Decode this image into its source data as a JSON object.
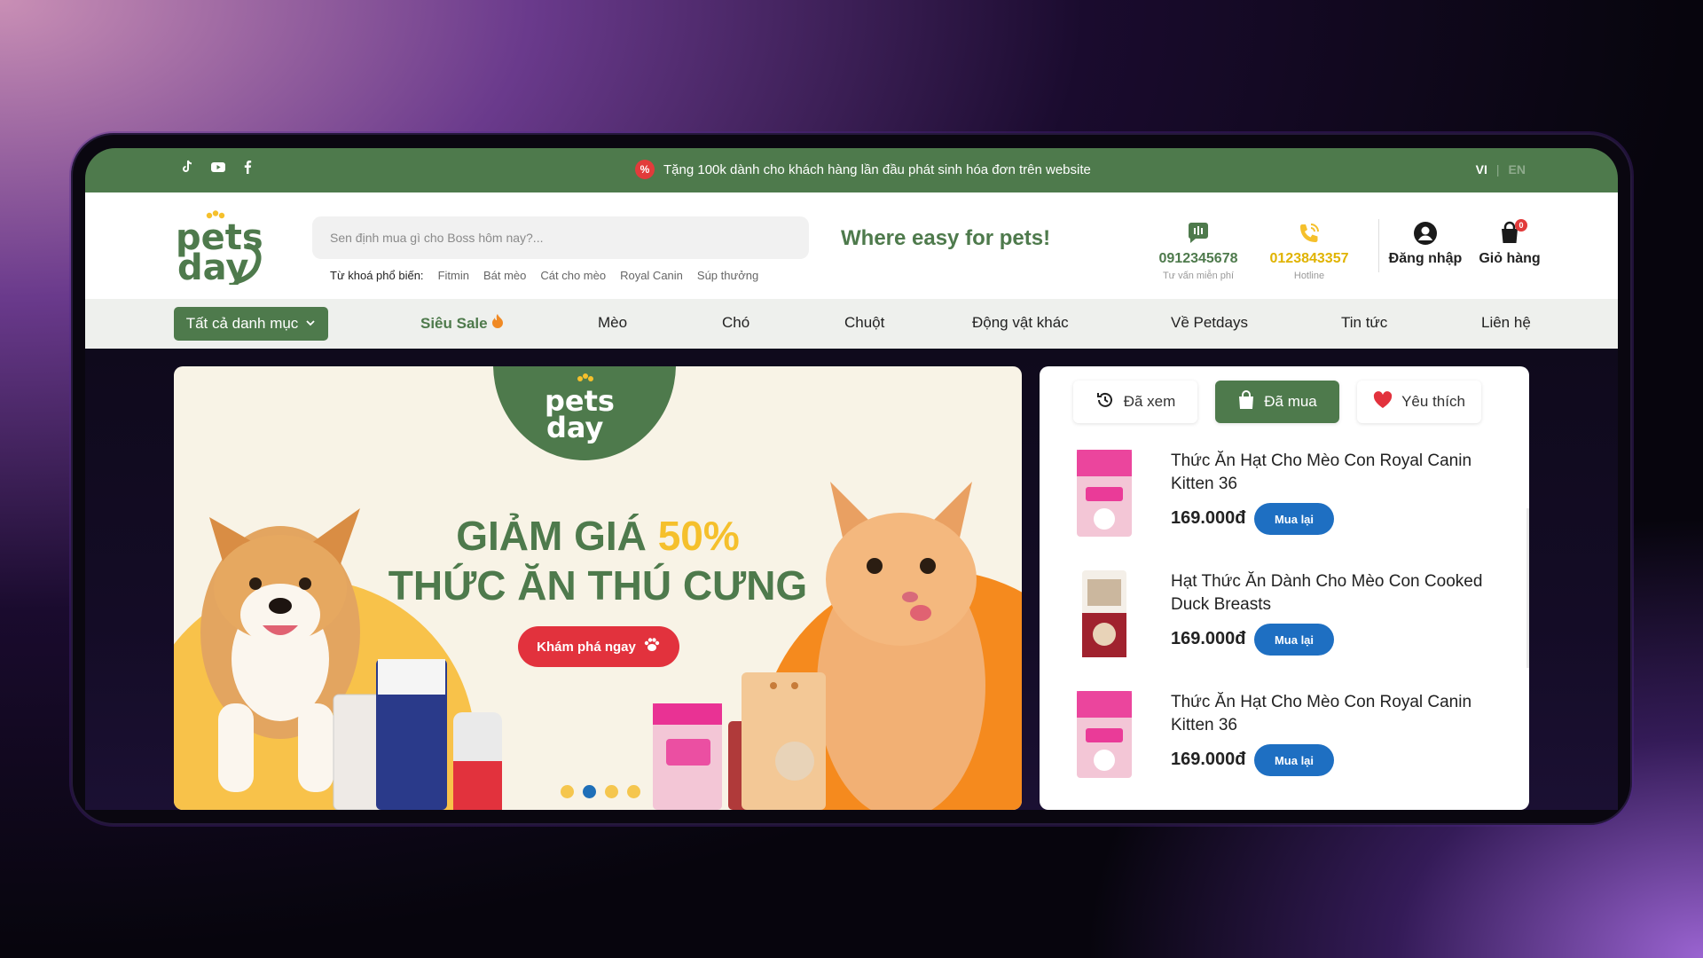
{
  "topbar": {
    "socials": [
      "tiktok-icon",
      "youtube-icon",
      "facebook-icon"
    ],
    "promo_badge": "%",
    "promo_text": "Tặng 100k dành cho khách hàng lần đầu phát sinh hóa đơn trên website",
    "lang_vi": "VI",
    "lang_en": "EN"
  },
  "header": {
    "logo_line1": "pets",
    "logo_line2": "day",
    "search_placeholder": "Sen định mua gì cho Boss hôm nay?...",
    "keywords_label": "Từ khoá phổ biến:",
    "keywords": [
      "Fitmin",
      "Bát mèo",
      "Cát cho mèo",
      "Royal Canin",
      "Súp thưởng"
    ],
    "tagline": "Where easy for pets!",
    "consult_phone": "0912345678",
    "consult_label": "Tư vấn miễn phí",
    "hotline_phone": "0123843357",
    "hotline_label": "Hotline",
    "login_label": "Đăng nhập",
    "cart_label": "Giỏ hàng",
    "cart_count": "0"
  },
  "nav": {
    "all_categories": "Tất cả danh mục",
    "items": [
      "Siêu Sale",
      "Mèo",
      "Chó",
      "Chuột",
      "Động vật khác",
      "Về Petdays",
      "Tin tức",
      "Liên hệ"
    ]
  },
  "banner": {
    "headline_prefix": "GIẢM GIÁ",
    "headline_highlight": "50%",
    "headline_line2": "THỨC ĂN THÚ CƯNG",
    "cta_label": "Khám phá ngay",
    "slides": 4,
    "active_slide": 2
  },
  "sidebar": {
    "tabs": [
      {
        "label": "Đã xem",
        "icon": "history-icon"
      },
      {
        "label": "Đã mua",
        "icon": "shopping-bag-icon"
      },
      {
        "label": "Yêu thích",
        "icon": "heart-icon"
      }
    ],
    "active_tab": "Đã mua",
    "products": [
      {
        "name": "Thức Ăn Hạt Cho Mèo Con Royal Canin Kitten 36",
        "price": "169.000đ",
        "action": "Mua lại"
      },
      {
        "name": "Hạt Thức Ăn Dành Cho Mèo Con Cooked Duck Breasts",
        "price": "169.000đ",
        "action": "Mua lại"
      },
      {
        "name": "Thức Ăn Hạt Cho Mèo Con Royal Canin Kitten 36",
        "price": "169.000đ",
        "action": "Mua lại"
      }
    ]
  },
  "colors": {
    "brand_green": "#4e7a4c",
    "accent_yellow": "#f5c02c",
    "cta_red": "#e2323d",
    "button_blue": "#1e6fc2"
  }
}
